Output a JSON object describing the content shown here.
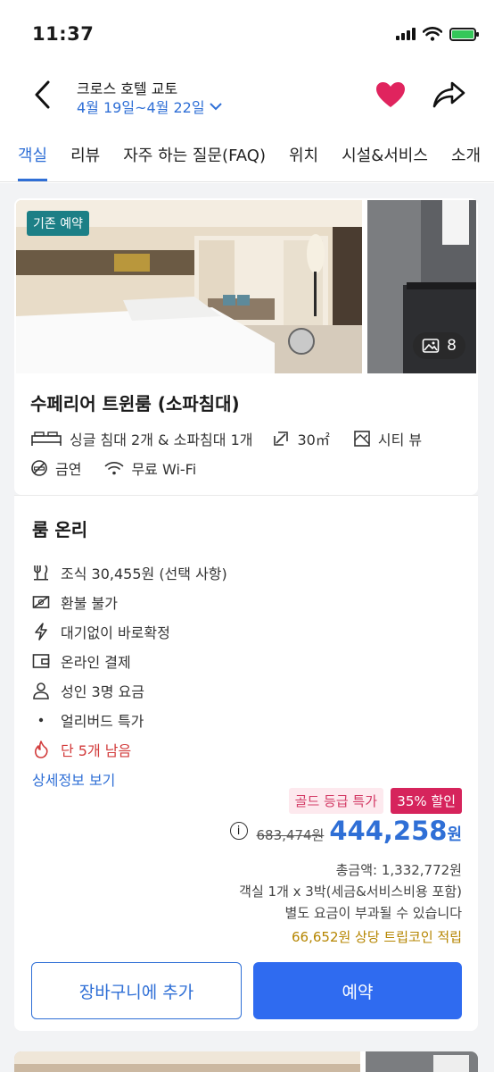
{
  "status": {
    "time": "11:37"
  },
  "header": {
    "hotel_name": "크로스 호텔 교토",
    "dates": "4월 19일~4월 22일"
  },
  "tabs": [
    {
      "label": "객실"
    },
    {
      "label": "리뷰"
    },
    {
      "label": "자주 하는 질문(FAQ)"
    },
    {
      "label": "위치"
    },
    {
      "label": "시설&서비스"
    },
    {
      "label": "소개"
    }
  ],
  "room": {
    "badge": "기존 예약",
    "photo_count": "8",
    "title": "수페리어 트윈룸 (소파침대)",
    "bed": "싱글 침대 2개 & 소파침대 1개",
    "size": "30㎡",
    "view": "시티 뷰",
    "smoking": "금연",
    "wifi": "무료 Wi-Fi"
  },
  "rate": {
    "title": "룸 온리",
    "features": [
      {
        "icon": "cutlery-icon",
        "text": "조식 30,455원 (선택 사항)"
      },
      {
        "icon": "no-refund-icon",
        "text": "환불 불가"
      },
      {
        "icon": "lightning-icon",
        "text": "대기없이 바로확정"
      },
      {
        "icon": "wallet-icon",
        "text": "온라인 결제"
      },
      {
        "icon": "person-icon",
        "text": "성인 3명 요금"
      },
      {
        "icon": "dot-icon",
        "text": "얼리버드 특가"
      },
      {
        "icon": "fire-icon",
        "text": "단 5개 남음"
      }
    ],
    "detail_link": "상세정보 보기",
    "gold_tag": "골드 등급 특가",
    "discount_tag": "35% 할인",
    "old_price": "683,474원",
    "new_price": "444,258",
    "currency": "원",
    "total": "총금액: 1,332,772원",
    "breakdown": "객실 1개 x 3박(세금&서비스비용 포함)",
    "extra_fee": "별도 요금이 부과될 수 있습니다",
    "coins": "66,652원 상당 트립코인 적립",
    "cart_button": "장바구니에 추가",
    "book_button": "예약"
  },
  "colors": {
    "accent": "#2f6fd6",
    "heart": "#e0245e",
    "discount": "#d6245c",
    "warning": "#d23b3b",
    "coins": "#b58500"
  }
}
